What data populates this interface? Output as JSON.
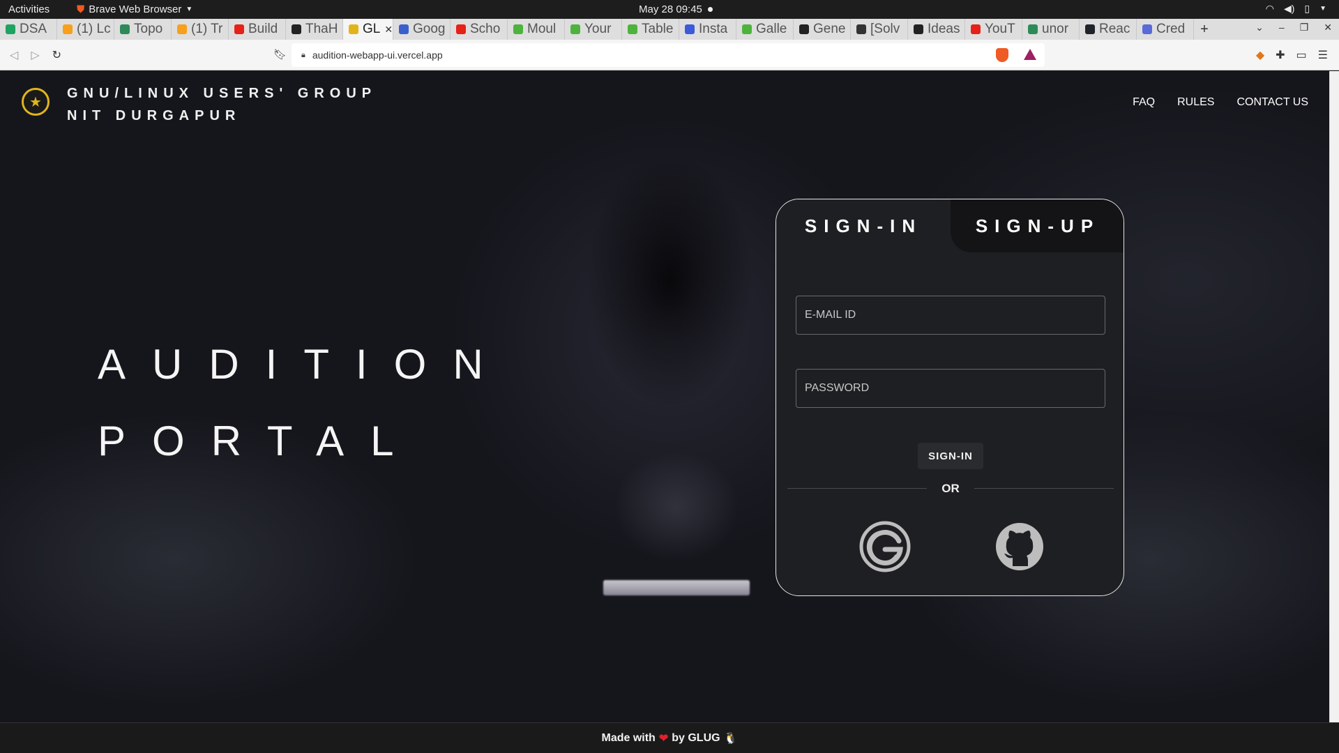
{
  "system": {
    "activities": "Activities",
    "app_name": "Brave Web Browser",
    "clock": "May 28  09:45"
  },
  "tabs": [
    {
      "label": "DSA",
      "icon": "sheets-icon",
      "color": "#1ea362"
    },
    {
      "label": "(1) Lc",
      "icon": "leetcode-icon",
      "color": "#f89f1b"
    },
    {
      "label": "Topo",
      "icon": "loop-icon",
      "color": "#2e8b57"
    },
    {
      "label": "(1) Tr",
      "icon": "leetcode-icon",
      "color": "#f89f1b"
    },
    {
      "label": "Build",
      "icon": "youtube-icon",
      "color": "#e62117"
    },
    {
      "label": "ThaH",
      "icon": "github-icon",
      "color": "#222222"
    },
    {
      "label": "GL",
      "icon": "glug-icon",
      "color": "#e2b41b"
    },
    {
      "label": "Goog",
      "icon": "chrome-icon",
      "color": "#3a5fcd"
    },
    {
      "label": "Scho",
      "icon": "youtube-icon",
      "color": "#e62117"
    },
    {
      "label": "Moul",
      "icon": "mongodb-icon",
      "color": "#4db33d"
    },
    {
      "label": "Your",
      "icon": "mongodb-icon",
      "color": "#4db33d"
    },
    {
      "label": "Table",
      "icon": "mongodb-icon",
      "color": "#4db33d"
    },
    {
      "label": "Insta",
      "icon": "wave-icon",
      "color": "#3b5bdb"
    },
    {
      "label": "Galle",
      "icon": "mongodb-icon",
      "color": "#4db33d"
    },
    {
      "label": "Gene",
      "icon": "github-icon",
      "color": "#222222"
    },
    {
      "label": "[Solv",
      "icon": "doc-icon",
      "color": "#333333"
    },
    {
      "label": "Ideas",
      "icon": "github-icon",
      "color": "#222222"
    },
    {
      "label": "YouT",
      "icon": "youtube-icon",
      "color": "#e62117"
    },
    {
      "label": "unor",
      "icon": "loop-icon",
      "color": "#2e8b57"
    },
    {
      "label": "Reac",
      "icon": "react-icon",
      "color": "#20232a"
    },
    {
      "label": "Cred",
      "icon": "api-icon",
      "color": "#5a6ad8"
    }
  ],
  "address": {
    "url": "audition-webapp-ui.vercel.app"
  },
  "site": {
    "org_line1": "GNU/LINUX USERS' GROUP",
    "org_line2": "NIT DURGAPUR",
    "nav": [
      "FAQ",
      "RULES",
      "CONTACT US"
    ],
    "hero_line1": "AUDITION",
    "hero_line2": "PORTAL"
  },
  "card": {
    "tab_signin": "SIGN-IN",
    "tab_signup": "SIGN-UP",
    "email_placeholder": "E-MAIL ID",
    "password_placeholder": "PASSWORD",
    "signin_button": "SIGN-IN",
    "or_text": "OR"
  },
  "footer": {
    "made_with": "Made with",
    "by_text": "by GLUG",
    "penguin": "🐧"
  },
  "colors": {
    "card_bg": "#1e1f22",
    "accent_logo": "#e2b41b",
    "heart": "#e0202a"
  }
}
